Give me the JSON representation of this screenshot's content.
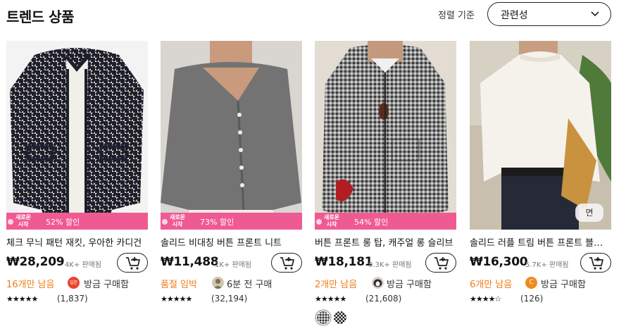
{
  "section": {
    "title": "트렌드 상품",
    "sort_label": "정렬 기준",
    "sort_value": "관련성"
  },
  "products": [
    {
      "name": "체크 무늬 패턴 재킷, 우아한 카디건",
      "price": "₩28,209",
      "sold": "4K+ 판매됨",
      "promo_tag_line1": "새로운",
      "promo_tag_line2": "시작",
      "promo_discount": "52% 할인",
      "stock": "16개만 남음",
      "buyer_badge": "일본",
      "buyer_text": "방금 구매함",
      "stars": "★★★★★",
      "reviews": "(1,837)"
    },
    {
      "name": "솔리드 비대칭 버튼 프론트 니트",
      "price": "₩11,488",
      "sold": "1K+ 판매됨",
      "promo_tag_line1": "새로운",
      "promo_tag_line2": "시작",
      "promo_discount": "73% 할인",
      "stock": "품절 임박",
      "buyer_text": "6분 전 구매",
      "stars": "★★★★★",
      "reviews": "(32,194)"
    },
    {
      "name": "버튼 프론트 롱 탑, 캐주얼 롱 슬리브",
      "price": "₩18,181",
      "sold": "9.3K+ 판매됨",
      "promo_tag_line1": "새로운",
      "promo_tag_line2": "시작",
      "promo_discount": "54% 할인",
      "stock": "2개만 남음",
      "buyer_text": "방금 구매함",
      "stars": "★★★★★",
      "reviews": "(21,608)"
    },
    {
      "name": "솔리드 러플 트림 버튼 프론트 블라우스",
      "price": "₩16,300",
      "sold": "5.7K+ 판매됨",
      "badge": "면",
      "stock": "6개만 남음",
      "buyer_badge": "C",
      "buyer_text": "방금 구매함",
      "stars": "★★★★☆",
      "reviews": "(126)"
    }
  ],
  "colors": {
    "promo_pink": "#f05a92",
    "stock_orange": "#f07c18",
    "border_dark": "#222222"
  },
  "icons": [
    "chevron-down-icon",
    "add-to-cart-icon",
    "star-icon"
  ]
}
